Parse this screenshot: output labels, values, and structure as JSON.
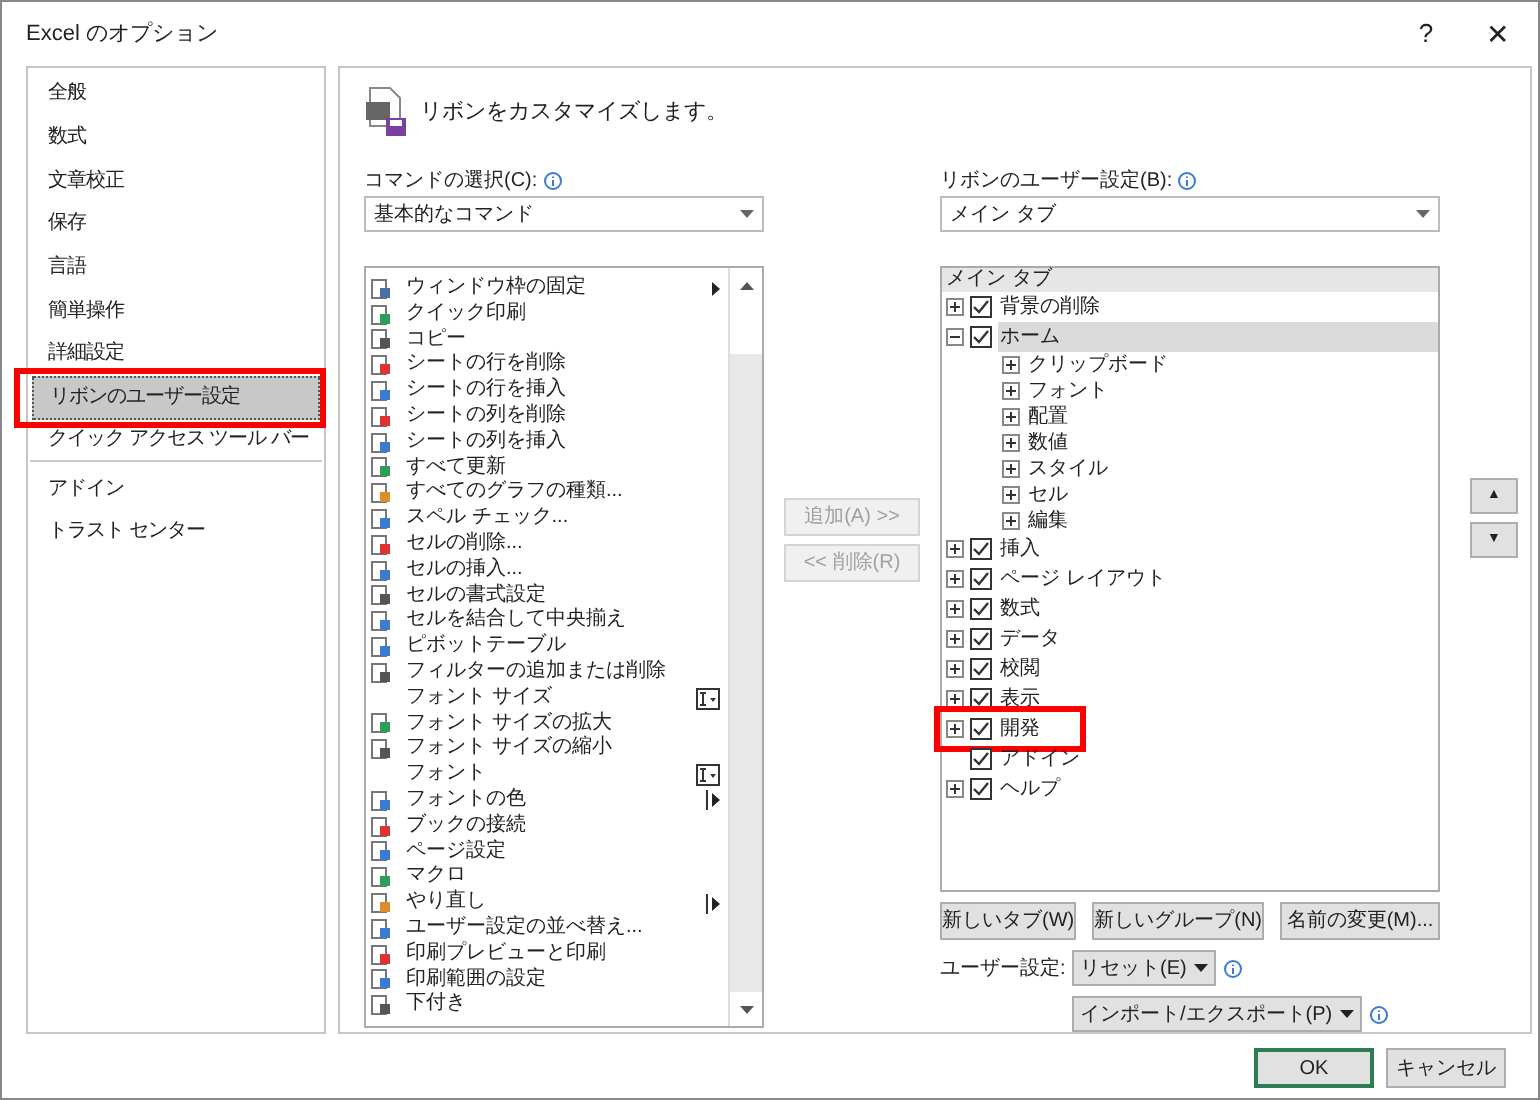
{
  "window": {
    "title": "Excel のオプション",
    "help": "?",
    "close": "✕"
  },
  "sidebar": {
    "items": [
      {
        "label": "全般",
        "selected": false,
        "highlighted": false,
        "divider_after": false
      },
      {
        "label": "数式",
        "selected": false,
        "highlighted": false,
        "divider_after": false
      },
      {
        "label": "文章校正",
        "selected": false,
        "highlighted": false,
        "divider_after": false
      },
      {
        "label": "保存",
        "selected": false,
        "highlighted": false,
        "divider_after": false
      },
      {
        "label": "言語",
        "selected": false,
        "highlighted": false,
        "divider_after": false
      },
      {
        "label": "簡単操作",
        "selected": false,
        "highlighted": false,
        "divider_after": false
      },
      {
        "label": "詳細設定",
        "selected": false,
        "highlighted": false,
        "divider_after": false
      },
      {
        "label": "リボンのユーザー設定",
        "selected": true,
        "highlighted": true,
        "divider_after": false
      },
      {
        "label": "クイック アクセス ツール バー",
        "selected": false,
        "highlighted": false,
        "divider_after": true
      },
      {
        "label": "アドイン",
        "selected": false,
        "highlighted": false,
        "divider_after": false
      },
      {
        "label": "トラスト センター",
        "selected": false,
        "highlighted": false,
        "divider_after": false
      }
    ]
  },
  "header": "リボンをカスタマイズします。",
  "commands": {
    "label": "コマンドの選択(C):",
    "dropdown": "基本的なコマンド",
    "items": [
      {
        "label": "ウィンドウ枠の固定",
        "icon": true,
        "kind": "submenu"
      },
      {
        "label": "クイック印刷",
        "icon": true,
        "kind": "plain"
      },
      {
        "label": "コピー",
        "icon": true,
        "kind": "plain"
      },
      {
        "label": "シートの行を削除",
        "icon": true,
        "kind": "plain"
      },
      {
        "label": "シートの行を挿入",
        "icon": true,
        "kind": "plain"
      },
      {
        "label": "シートの列を削除",
        "icon": true,
        "kind": "plain"
      },
      {
        "label": "シートの列を挿入",
        "icon": true,
        "kind": "plain"
      },
      {
        "label": "すべて更新",
        "icon": true,
        "kind": "plain"
      },
      {
        "label": "すべてのグラフの種類...",
        "icon": true,
        "kind": "plain"
      },
      {
        "label": "スペル チェック...",
        "icon": true,
        "kind": "plain"
      },
      {
        "label": "セルの削除...",
        "icon": true,
        "kind": "plain"
      },
      {
        "label": "セルの挿入...",
        "icon": true,
        "kind": "plain"
      },
      {
        "label": "セルの書式設定",
        "icon": true,
        "kind": "plain"
      },
      {
        "label": "セルを結合して中央揃え",
        "icon": true,
        "kind": "plain"
      },
      {
        "label": "ピボットテーブル",
        "icon": true,
        "kind": "plain"
      },
      {
        "label": "フィルターの追加または削除",
        "icon": true,
        "kind": "plain"
      },
      {
        "label": "フォント サイズ",
        "icon": false,
        "kind": "combo"
      },
      {
        "label": "フォント サイズの拡大",
        "icon": true,
        "kind": "plain"
      },
      {
        "label": "フォント サイズの縮小",
        "icon": true,
        "kind": "plain"
      },
      {
        "label": "フォント",
        "icon": false,
        "kind": "combo"
      },
      {
        "label": "フォントの色",
        "icon": true,
        "kind": "split"
      },
      {
        "label": "ブックの接続",
        "icon": true,
        "kind": "plain"
      },
      {
        "label": "ページ設定",
        "icon": true,
        "kind": "plain"
      },
      {
        "label": "マクロ",
        "icon": true,
        "kind": "plain"
      },
      {
        "label": "やり直し",
        "icon": true,
        "kind": "split"
      },
      {
        "label": "ユーザー設定の並べ替え...",
        "icon": true,
        "kind": "plain"
      },
      {
        "label": "印刷プレビューと印刷",
        "icon": true,
        "kind": "plain"
      },
      {
        "label": "印刷範囲の設定",
        "icon": true,
        "kind": "plain"
      },
      {
        "label": "下付き",
        "icon": true,
        "kind": "plain"
      }
    ]
  },
  "middle_buttons": [
    {
      "label": "追加(A) >>",
      "disabled": true
    },
    {
      "label": "<< 削除(R)",
      "disabled": true
    }
  ],
  "ribbon": {
    "label": "リボンのユーザー設定(B):",
    "dropdown": "メイン タブ",
    "tree_header": "メイン タブ",
    "tree": [
      {
        "label": "背景の削除",
        "kind": "expandable",
        "expanded": false,
        "checked": true,
        "selected": false,
        "highlighted": false
      },
      {
        "label": "ホーム",
        "kind": "expandable",
        "expanded": true,
        "checked": true,
        "selected": true,
        "highlighted": false,
        "children": [
          {
            "label": "クリップボード",
            "expanded": false
          },
          {
            "label": "フォント",
            "expanded": false
          },
          {
            "label": "配置",
            "expanded": false
          },
          {
            "label": "数値",
            "expanded": false
          },
          {
            "label": "スタイル",
            "expanded": false
          },
          {
            "label": "セル",
            "expanded": false
          },
          {
            "label": "編集",
            "expanded": false
          }
        ]
      },
      {
        "label": "挿入",
        "kind": "expandable",
        "expanded": false,
        "checked": true,
        "selected": false,
        "highlighted": false
      },
      {
        "label": "ページ レイアウト",
        "kind": "expandable",
        "expanded": false,
        "checked": true,
        "selected": false,
        "highlighted": false
      },
      {
        "label": "数式",
        "kind": "expandable",
        "expanded": false,
        "checked": true,
        "selected": false,
        "highlighted": false
      },
      {
        "label": "データ",
        "kind": "expandable",
        "expanded": false,
        "checked": true,
        "selected": false,
        "highlighted": false
      },
      {
        "label": "校閲",
        "kind": "expandable",
        "expanded": false,
        "checked": true,
        "selected": false,
        "highlighted": false
      },
      {
        "label": "表示",
        "kind": "expandable",
        "expanded": false,
        "checked": true,
        "selected": false,
        "highlighted": false
      },
      {
        "label": "開発",
        "kind": "expandable",
        "expanded": false,
        "checked": true,
        "selected": false,
        "highlighted": true
      },
      {
        "label": "アドイン",
        "kind": "leaf",
        "checked": true,
        "selected": false,
        "highlighted": false
      },
      {
        "label": "ヘルプ",
        "kind": "expandable",
        "expanded": false,
        "checked": true,
        "selected": false,
        "highlighted": false
      }
    ],
    "move_buttons": [
      "▲",
      "▼"
    ],
    "buttons": [
      "新しいタブ(W)",
      "新しいグループ(N)",
      "名前の変更(M)..."
    ],
    "custom_label": "ユーザー設定:",
    "reset": "リセット(E)",
    "import_export": "インポート/エクスポート(P)"
  },
  "footer": {
    "ok": "OK",
    "cancel": "キャンセル"
  }
}
